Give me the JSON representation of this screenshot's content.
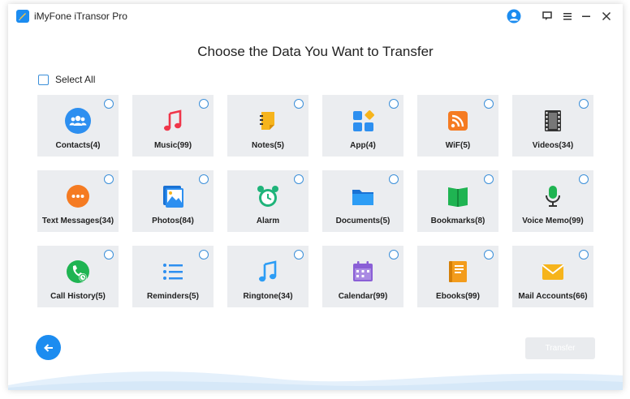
{
  "app": {
    "title": "iMyFone iTransor Pro"
  },
  "header": {
    "heading": "Choose the Data You Want to Transfer"
  },
  "select_all": {
    "label": "Select All",
    "checked": false
  },
  "categories": [
    {
      "label": "Contacts(4)",
      "icon": "contacts-icon"
    },
    {
      "label": "Music(99)",
      "icon": "music-icon"
    },
    {
      "label": "Notes(5)",
      "icon": "notes-icon"
    },
    {
      "label": "App(4)",
      "icon": "app-icon"
    },
    {
      "label": "WiF(5)",
      "icon": "wifi-icon"
    },
    {
      "label": "Videos(34)",
      "icon": "videos-icon"
    },
    {
      "label": "Text Messages(34)",
      "icon": "messages-icon"
    },
    {
      "label": "Photos(84)",
      "icon": "photos-icon"
    },
    {
      "label": "Alarm",
      "icon": "alarm-icon"
    },
    {
      "label": "Documents(5)",
      "icon": "folder-icon"
    },
    {
      "label": "Bookmarks(8)",
      "icon": "bookmark-icon"
    },
    {
      "label": "Voice Memo(99)",
      "icon": "microphone-icon"
    },
    {
      "label": "Call History(5)",
      "icon": "phone-icon"
    },
    {
      "label": "Reminders(5)",
      "icon": "list-icon"
    },
    {
      "label": "Ringtone(34)",
      "icon": "ringtone-icon"
    },
    {
      "label": "Calendar(99)",
      "icon": "calendar-icon"
    },
    {
      "label": "Ebooks(99)",
      "icon": "book-icon"
    },
    {
      "label": "Mail Accounts(66)",
      "icon": "mail-icon"
    }
  ],
  "footer": {
    "transfer_label": "Transfer",
    "transfer_enabled": false
  },
  "colors": {
    "accent": "#1c8cf0",
    "tile_bg": "#ebedf0",
    "radio_border": "#3b8fd9"
  }
}
